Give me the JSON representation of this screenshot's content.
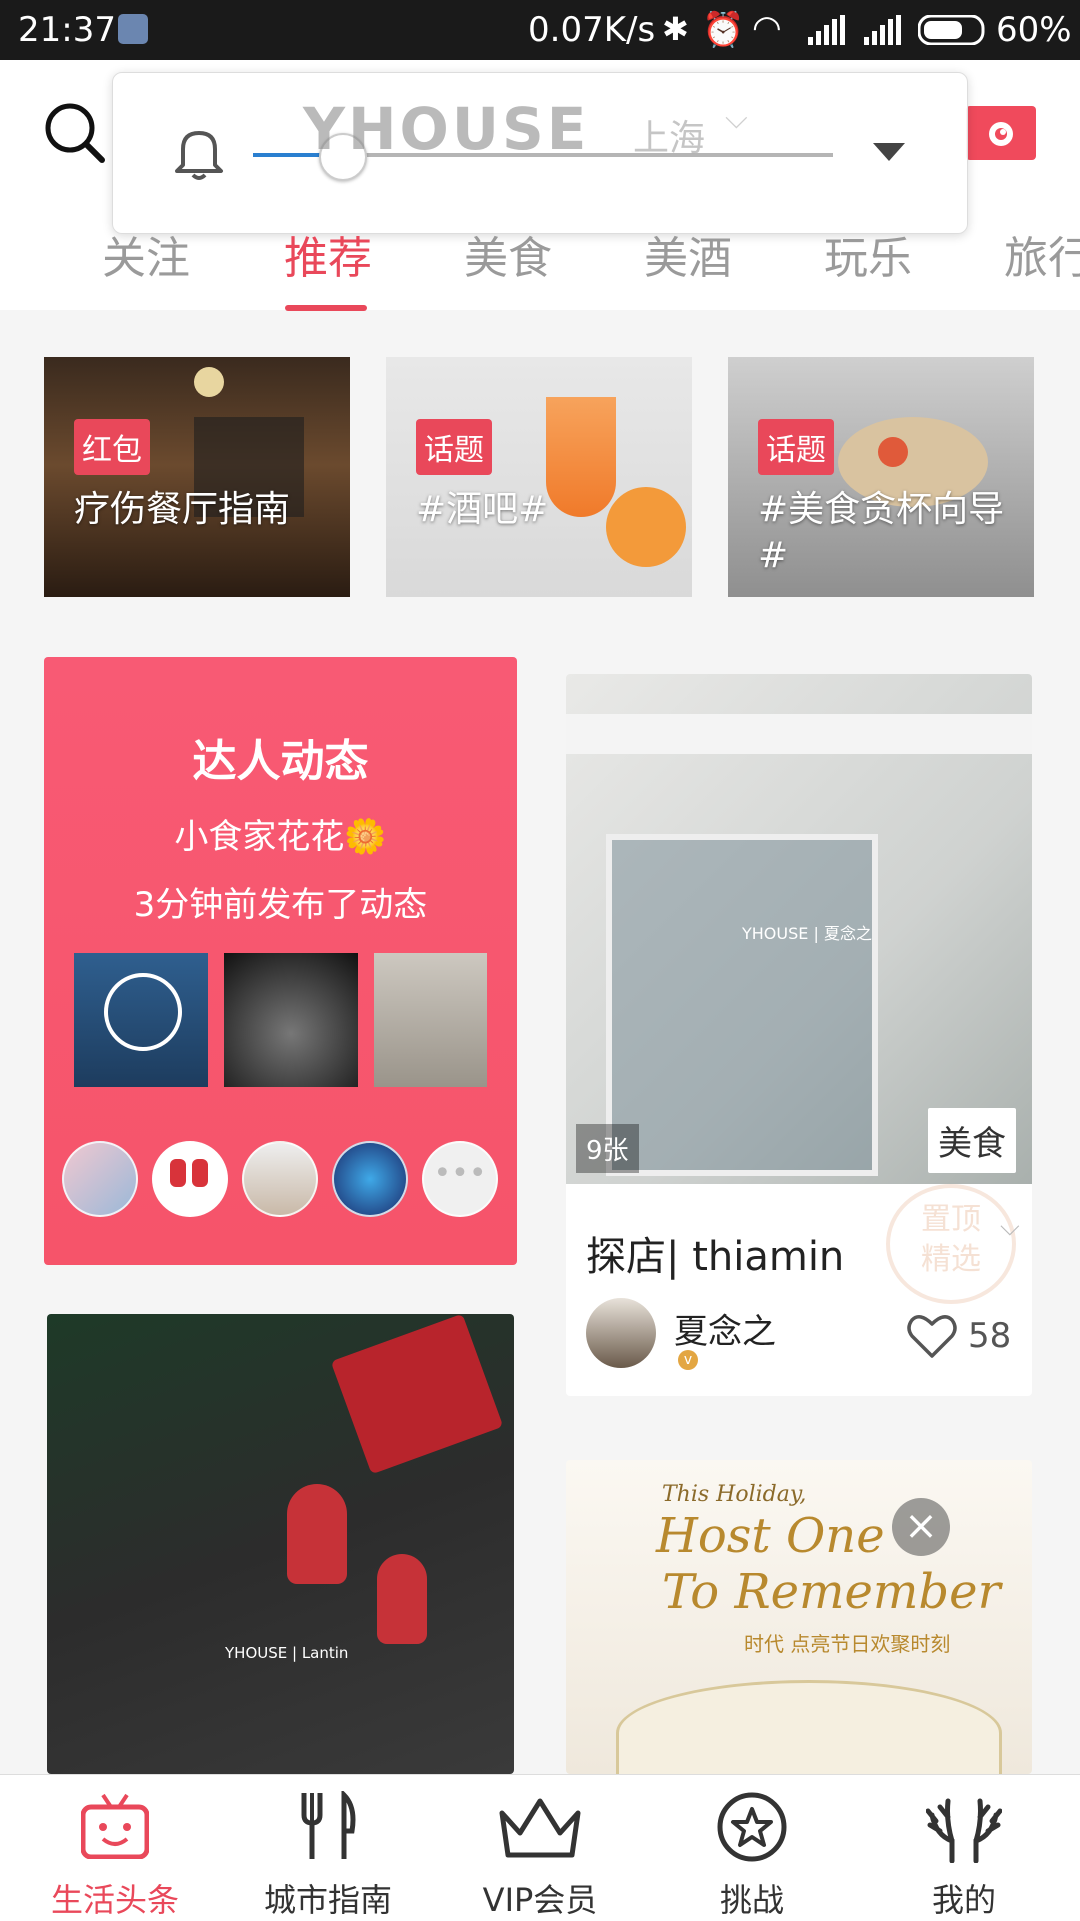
{
  "status_bar": {
    "time": "21:37",
    "net_speed": "0.07K/s",
    "battery": "60%"
  },
  "header": {
    "logo_text": "YHOUSE",
    "city": "上海"
  },
  "tabs": [
    {
      "label": "关注",
      "active": false
    },
    {
      "label": "推荐",
      "active": true
    },
    {
      "label": "美食",
      "active": false
    },
    {
      "label": "美酒",
      "active": false
    },
    {
      "label": "玩乐",
      "active": false
    },
    {
      "label": "旅行",
      "active": false
    }
  ],
  "topics": [
    {
      "badge": "红包",
      "title": "疗伤餐厅指南"
    },
    {
      "badge": "话题",
      "title": "#酒吧#"
    },
    {
      "badge": "话题",
      "title": "#美食贪杯向导#"
    }
  ],
  "expert_card": {
    "title": "达人动态",
    "user": "小食家花花🌼",
    "activity": "3分钟前发布了动态"
  },
  "post_card": {
    "image_watermark": "YHOUSE | 夏念之",
    "photo_count": "9张",
    "category": "美食",
    "title": "探店| thiamin",
    "stamp_text": "置顶精选",
    "author": "夏念之",
    "likes": "58"
  },
  "lower_left_card": {
    "image_watermark": "YHOUSE | Lantin"
  },
  "lower_right_card": {
    "line1": "This Holiday,",
    "line2": "Host One",
    "line3": "To Remember",
    "line4": "时代 点亮节日欢聚时刻"
  },
  "bottom_nav": [
    {
      "label": "生活头条",
      "active": true
    },
    {
      "label": "城市指南",
      "active": false
    },
    {
      "label": "VIP会员",
      "active": false
    },
    {
      "label": "挑战",
      "active": false
    },
    {
      "label": "我的",
      "active": false
    }
  ],
  "colors": {
    "accent": "#e9485a",
    "expert_bg": "#f6546a",
    "slider_blue": "#2a7fd0"
  }
}
